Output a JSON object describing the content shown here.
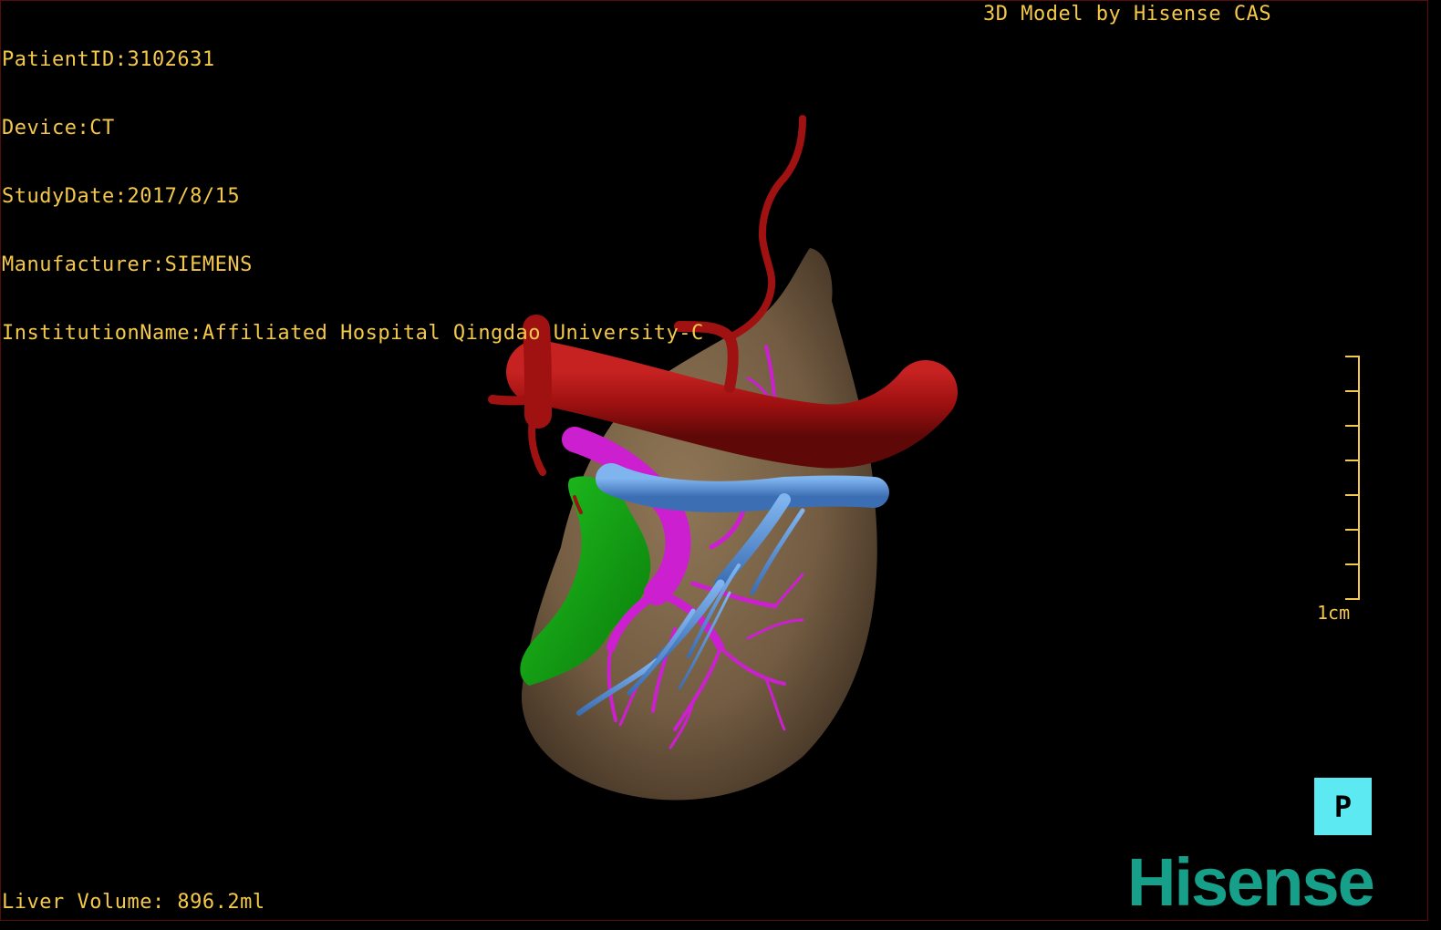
{
  "overlay": {
    "info_lines": [
      "PatientID:3102631",
      "Device:CT",
      "StudyDate:2017/8/15",
      "Manufacturer:SIEMENS",
      "InstitutionName:Affiliated Hospital Qingdao University-C"
    ],
    "brand_text": "3D Model by Hisense CAS",
    "liver_volume": "Liver Volume: 896.2ml"
  },
  "ruler": {
    "label": "1cm",
    "ticks": 8
  },
  "orientation": {
    "label": "P"
  },
  "logo": {
    "text": "Hisense"
  },
  "colors": {
    "overlay_text": "#f4c84a",
    "liver": "#7b6449",
    "artery": "#b01414",
    "portal_vein": "#cc1fd0",
    "hepatic_vein": "#5a98e0",
    "gallbladder": "#16a016",
    "orientation_box": "#5ce9f2",
    "logo": "#16a08a"
  },
  "model": {
    "structures": [
      "liver",
      "artery",
      "portal-vein",
      "hepatic-vein",
      "gallbladder"
    ]
  }
}
